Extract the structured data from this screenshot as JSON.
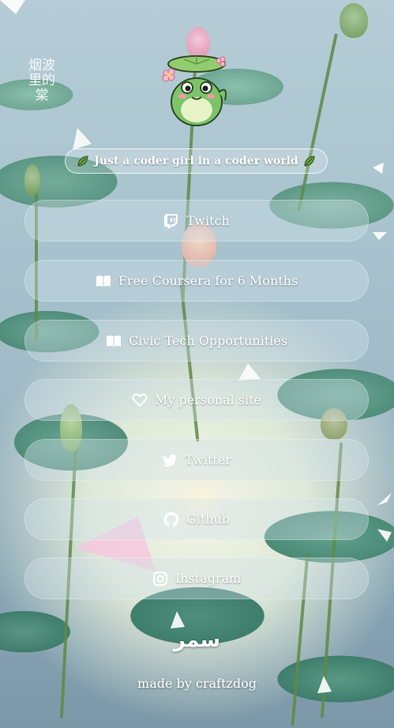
{
  "profile": {
    "calligraphy": "烟波里的棠",
    "avatar_icon": "frog-lilypad-avatar",
    "tagline": "Just a coder girl in a coder world",
    "tagline_icon": "leaf-icon"
  },
  "links": [
    {
      "label": "Twitch",
      "icon": "twitch-icon"
    },
    {
      "label": "Free Coursera for 6 Months",
      "icon": "book-icon"
    },
    {
      "label": "Civic Tech Opportunities",
      "icon": "book-icon"
    },
    {
      "label": "My personal site",
      "icon": "heart-icon"
    },
    {
      "label": "Twitter",
      "icon": "twitter-icon"
    },
    {
      "label": "Github",
      "icon": "github-icon"
    },
    {
      "label": "Instagram",
      "icon": "instagram-icon"
    }
  ],
  "footer": {
    "name": "سمر",
    "credit": "made by craftzdog"
  },
  "colors": {
    "button_bg": "#d2e1eb",
    "text": "#ffffff",
    "water": "#9fb9c6",
    "lilypad": "#4f8d7a",
    "frog": "#7cc36a"
  }
}
